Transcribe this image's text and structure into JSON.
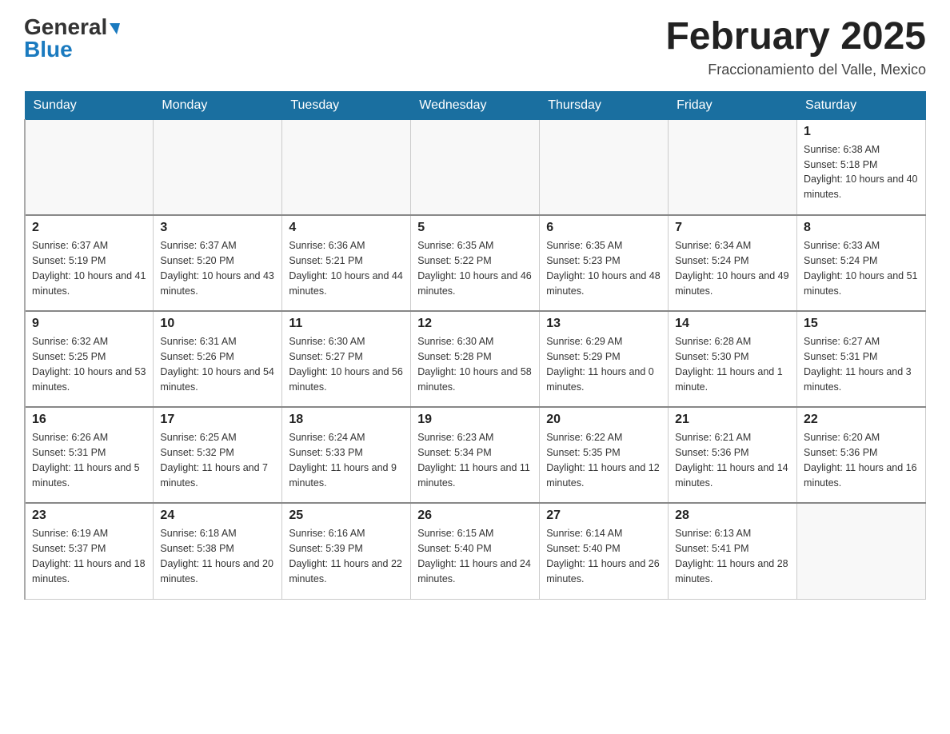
{
  "logo": {
    "general": "General",
    "blue": "Blue"
  },
  "title": "February 2025",
  "location": "Fraccionamiento del Valle, Mexico",
  "days_of_week": [
    "Sunday",
    "Monday",
    "Tuesday",
    "Wednesday",
    "Thursday",
    "Friday",
    "Saturday"
  ],
  "weeks": [
    [
      {
        "day": "",
        "info": ""
      },
      {
        "day": "",
        "info": ""
      },
      {
        "day": "",
        "info": ""
      },
      {
        "day": "",
        "info": ""
      },
      {
        "day": "",
        "info": ""
      },
      {
        "day": "",
        "info": ""
      },
      {
        "day": "1",
        "info": "Sunrise: 6:38 AM\nSunset: 5:18 PM\nDaylight: 10 hours and 40 minutes."
      }
    ],
    [
      {
        "day": "2",
        "info": "Sunrise: 6:37 AM\nSunset: 5:19 PM\nDaylight: 10 hours and 41 minutes."
      },
      {
        "day": "3",
        "info": "Sunrise: 6:37 AM\nSunset: 5:20 PM\nDaylight: 10 hours and 43 minutes."
      },
      {
        "day": "4",
        "info": "Sunrise: 6:36 AM\nSunset: 5:21 PM\nDaylight: 10 hours and 44 minutes."
      },
      {
        "day": "5",
        "info": "Sunrise: 6:35 AM\nSunset: 5:22 PM\nDaylight: 10 hours and 46 minutes."
      },
      {
        "day": "6",
        "info": "Sunrise: 6:35 AM\nSunset: 5:23 PM\nDaylight: 10 hours and 48 minutes."
      },
      {
        "day": "7",
        "info": "Sunrise: 6:34 AM\nSunset: 5:24 PM\nDaylight: 10 hours and 49 minutes."
      },
      {
        "day": "8",
        "info": "Sunrise: 6:33 AM\nSunset: 5:24 PM\nDaylight: 10 hours and 51 minutes."
      }
    ],
    [
      {
        "day": "9",
        "info": "Sunrise: 6:32 AM\nSunset: 5:25 PM\nDaylight: 10 hours and 53 minutes."
      },
      {
        "day": "10",
        "info": "Sunrise: 6:31 AM\nSunset: 5:26 PM\nDaylight: 10 hours and 54 minutes."
      },
      {
        "day": "11",
        "info": "Sunrise: 6:30 AM\nSunset: 5:27 PM\nDaylight: 10 hours and 56 minutes."
      },
      {
        "day": "12",
        "info": "Sunrise: 6:30 AM\nSunset: 5:28 PM\nDaylight: 10 hours and 58 minutes."
      },
      {
        "day": "13",
        "info": "Sunrise: 6:29 AM\nSunset: 5:29 PM\nDaylight: 11 hours and 0 minutes."
      },
      {
        "day": "14",
        "info": "Sunrise: 6:28 AM\nSunset: 5:30 PM\nDaylight: 11 hours and 1 minute."
      },
      {
        "day": "15",
        "info": "Sunrise: 6:27 AM\nSunset: 5:31 PM\nDaylight: 11 hours and 3 minutes."
      }
    ],
    [
      {
        "day": "16",
        "info": "Sunrise: 6:26 AM\nSunset: 5:31 PM\nDaylight: 11 hours and 5 minutes."
      },
      {
        "day": "17",
        "info": "Sunrise: 6:25 AM\nSunset: 5:32 PM\nDaylight: 11 hours and 7 minutes."
      },
      {
        "day": "18",
        "info": "Sunrise: 6:24 AM\nSunset: 5:33 PM\nDaylight: 11 hours and 9 minutes."
      },
      {
        "day": "19",
        "info": "Sunrise: 6:23 AM\nSunset: 5:34 PM\nDaylight: 11 hours and 11 minutes."
      },
      {
        "day": "20",
        "info": "Sunrise: 6:22 AM\nSunset: 5:35 PM\nDaylight: 11 hours and 12 minutes."
      },
      {
        "day": "21",
        "info": "Sunrise: 6:21 AM\nSunset: 5:36 PM\nDaylight: 11 hours and 14 minutes."
      },
      {
        "day": "22",
        "info": "Sunrise: 6:20 AM\nSunset: 5:36 PM\nDaylight: 11 hours and 16 minutes."
      }
    ],
    [
      {
        "day": "23",
        "info": "Sunrise: 6:19 AM\nSunset: 5:37 PM\nDaylight: 11 hours and 18 minutes."
      },
      {
        "day": "24",
        "info": "Sunrise: 6:18 AM\nSunset: 5:38 PM\nDaylight: 11 hours and 20 minutes."
      },
      {
        "day": "25",
        "info": "Sunrise: 6:16 AM\nSunset: 5:39 PM\nDaylight: 11 hours and 22 minutes."
      },
      {
        "day": "26",
        "info": "Sunrise: 6:15 AM\nSunset: 5:40 PM\nDaylight: 11 hours and 24 minutes."
      },
      {
        "day": "27",
        "info": "Sunrise: 6:14 AM\nSunset: 5:40 PM\nDaylight: 11 hours and 26 minutes."
      },
      {
        "day": "28",
        "info": "Sunrise: 6:13 AM\nSunset: 5:41 PM\nDaylight: 11 hours and 28 minutes."
      },
      {
        "day": "",
        "info": ""
      }
    ]
  ]
}
